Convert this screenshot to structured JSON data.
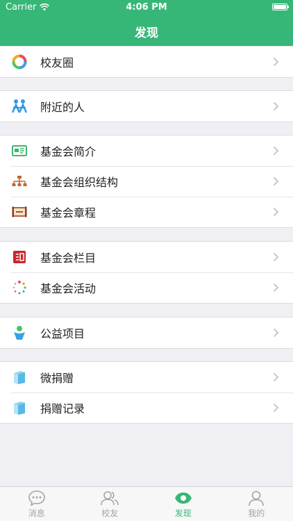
{
  "status_bar": {
    "carrier": "Carrier",
    "time": "4:06 PM"
  },
  "nav": {
    "title": "发现"
  },
  "colors": {
    "accent": "#37b777",
    "tab_inactive": "#a4a4a8"
  },
  "groups": [
    {
      "items": [
        {
          "label": "校友圈",
          "icon": "friends-circle-icon"
        }
      ]
    },
    {
      "items": [
        {
          "label": "附近的人",
          "icon": "nearby-people-icon"
        }
      ]
    },
    {
      "items": [
        {
          "label": "基金会简介",
          "icon": "intro-card-icon"
        },
        {
          "label": "基金会组织结构",
          "icon": "org-structure-icon"
        },
        {
          "label": "基金会章程",
          "icon": "charter-scroll-icon"
        }
      ]
    },
    {
      "items": [
        {
          "label": "基金会栏目",
          "icon": "column-book-icon"
        },
        {
          "label": "基金会活动",
          "icon": "activity-dots-icon"
        }
      ]
    },
    {
      "items": [
        {
          "label": "公益项目",
          "icon": "charity-person-icon"
        }
      ]
    },
    {
      "items": [
        {
          "label": "微捐赠",
          "icon": "donate-box-icon"
        },
        {
          "label": "捐赠记录",
          "icon": "donation-record-icon"
        }
      ]
    }
  ],
  "tabs": [
    {
      "label": "消息",
      "icon": "message-bubble-icon",
      "active": false
    },
    {
      "label": "校友",
      "icon": "alumni-icon",
      "active": false
    },
    {
      "label": "发现",
      "icon": "discover-eye-icon",
      "active": true
    },
    {
      "label": "我的",
      "icon": "profile-icon",
      "active": false
    }
  ]
}
